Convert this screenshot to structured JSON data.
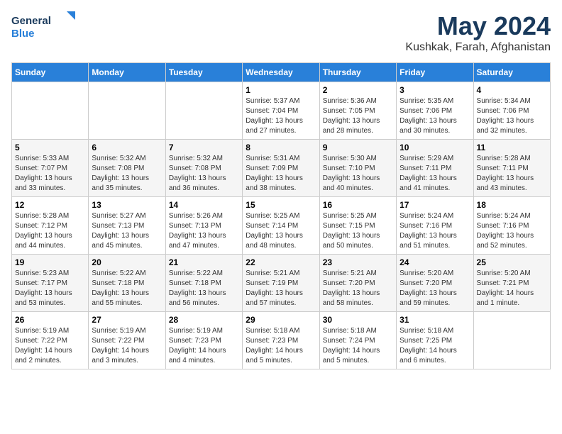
{
  "header": {
    "logo_line1": "General",
    "logo_line2": "Blue",
    "month_year": "May 2024",
    "location": "Kushkak, Farah, Afghanistan"
  },
  "days_of_week": [
    "Sunday",
    "Monday",
    "Tuesday",
    "Wednesday",
    "Thursday",
    "Friday",
    "Saturday"
  ],
  "weeks": [
    [
      {
        "day": "",
        "info": ""
      },
      {
        "day": "",
        "info": ""
      },
      {
        "day": "",
        "info": ""
      },
      {
        "day": "1",
        "info": "Sunrise: 5:37 AM\nSunset: 7:04 PM\nDaylight: 13 hours\nand 27 minutes."
      },
      {
        "day": "2",
        "info": "Sunrise: 5:36 AM\nSunset: 7:05 PM\nDaylight: 13 hours\nand 28 minutes."
      },
      {
        "day": "3",
        "info": "Sunrise: 5:35 AM\nSunset: 7:06 PM\nDaylight: 13 hours\nand 30 minutes."
      },
      {
        "day": "4",
        "info": "Sunrise: 5:34 AM\nSunset: 7:06 PM\nDaylight: 13 hours\nand 32 minutes."
      }
    ],
    [
      {
        "day": "5",
        "info": "Sunrise: 5:33 AM\nSunset: 7:07 PM\nDaylight: 13 hours\nand 33 minutes."
      },
      {
        "day": "6",
        "info": "Sunrise: 5:32 AM\nSunset: 7:08 PM\nDaylight: 13 hours\nand 35 minutes."
      },
      {
        "day": "7",
        "info": "Sunrise: 5:32 AM\nSunset: 7:08 PM\nDaylight: 13 hours\nand 36 minutes."
      },
      {
        "day": "8",
        "info": "Sunrise: 5:31 AM\nSunset: 7:09 PM\nDaylight: 13 hours\nand 38 minutes."
      },
      {
        "day": "9",
        "info": "Sunrise: 5:30 AM\nSunset: 7:10 PM\nDaylight: 13 hours\nand 40 minutes."
      },
      {
        "day": "10",
        "info": "Sunrise: 5:29 AM\nSunset: 7:11 PM\nDaylight: 13 hours\nand 41 minutes."
      },
      {
        "day": "11",
        "info": "Sunrise: 5:28 AM\nSunset: 7:11 PM\nDaylight: 13 hours\nand 43 minutes."
      }
    ],
    [
      {
        "day": "12",
        "info": "Sunrise: 5:28 AM\nSunset: 7:12 PM\nDaylight: 13 hours\nand 44 minutes."
      },
      {
        "day": "13",
        "info": "Sunrise: 5:27 AM\nSunset: 7:13 PM\nDaylight: 13 hours\nand 45 minutes."
      },
      {
        "day": "14",
        "info": "Sunrise: 5:26 AM\nSunset: 7:13 PM\nDaylight: 13 hours\nand 47 minutes."
      },
      {
        "day": "15",
        "info": "Sunrise: 5:25 AM\nSunset: 7:14 PM\nDaylight: 13 hours\nand 48 minutes."
      },
      {
        "day": "16",
        "info": "Sunrise: 5:25 AM\nSunset: 7:15 PM\nDaylight: 13 hours\nand 50 minutes."
      },
      {
        "day": "17",
        "info": "Sunrise: 5:24 AM\nSunset: 7:16 PM\nDaylight: 13 hours\nand 51 minutes."
      },
      {
        "day": "18",
        "info": "Sunrise: 5:24 AM\nSunset: 7:16 PM\nDaylight: 13 hours\nand 52 minutes."
      }
    ],
    [
      {
        "day": "19",
        "info": "Sunrise: 5:23 AM\nSunset: 7:17 PM\nDaylight: 13 hours\nand 53 minutes."
      },
      {
        "day": "20",
        "info": "Sunrise: 5:22 AM\nSunset: 7:18 PM\nDaylight: 13 hours\nand 55 minutes."
      },
      {
        "day": "21",
        "info": "Sunrise: 5:22 AM\nSunset: 7:18 PM\nDaylight: 13 hours\nand 56 minutes."
      },
      {
        "day": "22",
        "info": "Sunrise: 5:21 AM\nSunset: 7:19 PM\nDaylight: 13 hours\nand 57 minutes."
      },
      {
        "day": "23",
        "info": "Sunrise: 5:21 AM\nSunset: 7:20 PM\nDaylight: 13 hours\nand 58 minutes."
      },
      {
        "day": "24",
        "info": "Sunrise: 5:20 AM\nSunset: 7:20 PM\nDaylight: 13 hours\nand 59 minutes."
      },
      {
        "day": "25",
        "info": "Sunrise: 5:20 AM\nSunset: 7:21 PM\nDaylight: 14 hours\nand 1 minute."
      }
    ],
    [
      {
        "day": "26",
        "info": "Sunrise: 5:19 AM\nSunset: 7:22 PM\nDaylight: 14 hours\nand 2 minutes."
      },
      {
        "day": "27",
        "info": "Sunrise: 5:19 AM\nSunset: 7:22 PM\nDaylight: 14 hours\nand 3 minutes."
      },
      {
        "day": "28",
        "info": "Sunrise: 5:19 AM\nSunset: 7:23 PM\nDaylight: 14 hours\nand 4 minutes."
      },
      {
        "day": "29",
        "info": "Sunrise: 5:18 AM\nSunset: 7:23 PM\nDaylight: 14 hours\nand 5 minutes."
      },
      {
        "day": "30",
        "info": "Sunrise: 5:18 AM\nSunset: 7:24 PM\nDaylight: 14 hours\nand 5 minutes."
      },
      {
        "day": "31",
        "info": "Sunrise: 5:18 AM\nSunset: 7:25 PM\nDaylight: 14 hours\nand 6 minutes."
      },
      {
        "day": "",
        "info": ""
      }
    ]
  ]
}
